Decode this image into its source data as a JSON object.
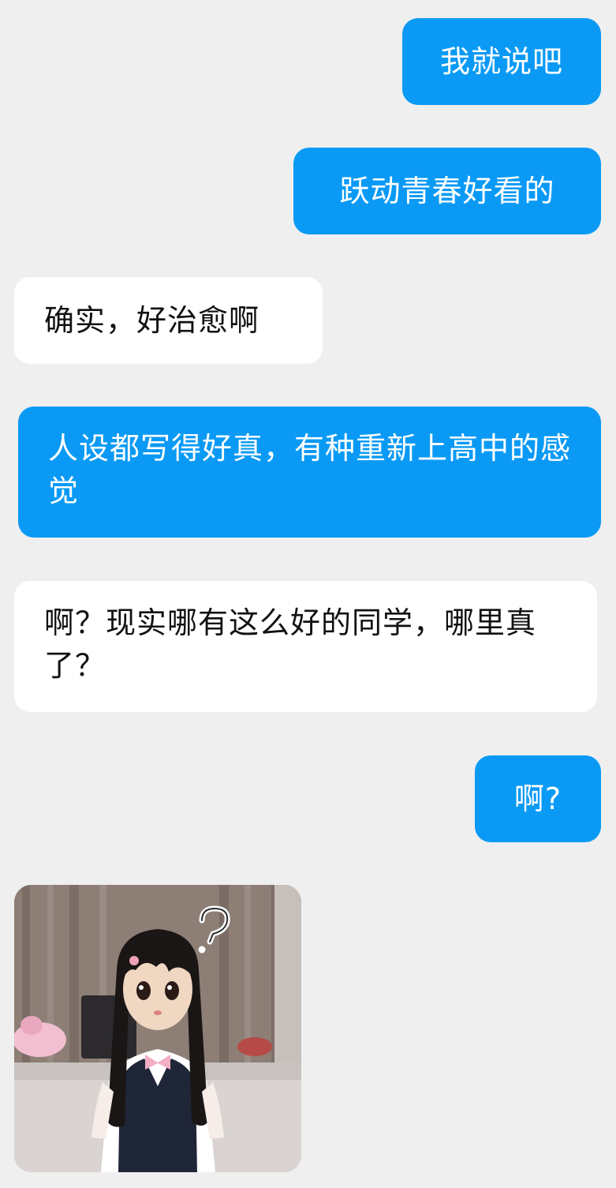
{
  "messages": [
    {
      "side": "sent",
      "text": "我就说吧"
    },
    {
      "side": "sent",
      "text": "跃动青春好看的"
    },
    {
      "side": "received",
      "text": "确实，好治愈啊"
    },
    {
      "side": "sent",
      "text": "人设都写得好真，有种重新上高中的感觉"
    },
    {
      "side": "received",
      "text": "啊？现实哪有这么好的同学，哪里真了？"
    },
    {
      "side": "sent",
      "text": "啊?"
    }
  ],
  "sticker": {
    "type": "image",
    "depicts": "person in anime mask and school uniform with question mark",
    "overlay_glyph": "?"
  },
  "colors": {
    "background": "#efefef",
    "sent_bubble": "#0a9af5",
    "received_bubble": "#ffffff"
  }
}
